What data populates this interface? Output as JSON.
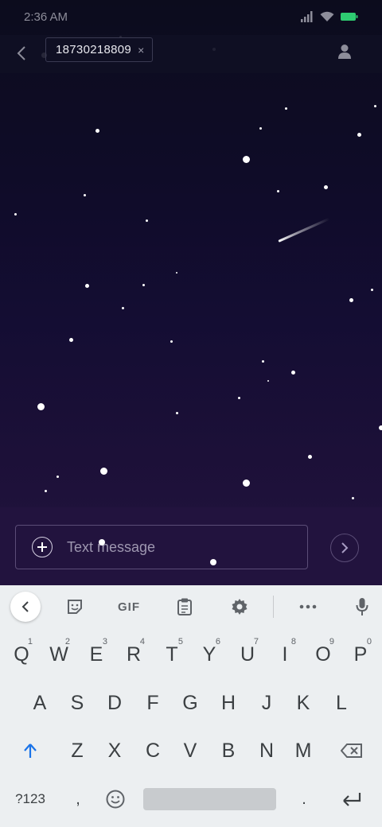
{
  "status_bar": {
    "time": "2:36 AM"
  },
  "header": {
    "recipient": "18730218809",
    "chip_close": "×"
  },
  "composer": {
    "placeholder": "Text message"
  },
  "keyboard": {
    "toolbar": {
      "gif_label": "GIF"
    },
    "row1": [
      {
        "key": "Q",
        "hint": "1"
      },
      {
        "key": "W",
        "hint": "2"
      },
      {
        "key": "E",
        "hint": "3"
      },
      {
        "key": "R",
        "hint": "4"
      },
      {
        "key": "T",
        "hint": "5"
      },
      {
        "key": "Y",
        "hint": "6"
      },
      {
        "key": "U",
        "hint": "7"
      },
      {
        "key": "I",
        "hint": "8"
      },
      {
        "key": "O",
        "hint": "9"
      },
      {
        "key": "P",
        "hint": "0"
      }
    ],
    "row2": [
      "A",
      "S",
      "D",
      "F",
      "G",
      "H",
      "J",
      "K",
      "L"
    ],
    "row3": [
      "Z",
      "X",
      "C",
      "V",
      "B",
      "N",
      "M"
    ],
    "row4": {
      "symbols": "?123",
      "comma": ",",
      "period": "."
    }
  },
  "colors": {
    "accent_blue": "#1a73e8",
    "battery_green": "#2ecc71",
    "sky_top": "#0c0c1d",
    "sky_bottom": "#23143f",
    "keyboard_bg": "#eceff1"
  }
}
